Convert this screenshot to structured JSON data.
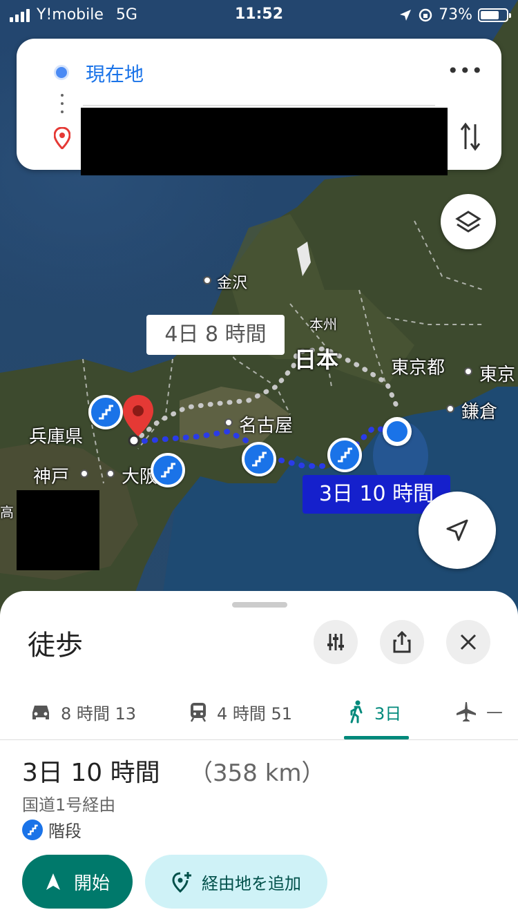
{
  "status_bar": {
    "carrier": "Y!mobile",
    "network": "5G",
    "time": "11:52",
    "battery": "73%"
  },
  "search": {
    "origin": "現在地",
    "destination": ""
  },
  "map": {
    "labels": {
      "kanazawa": "金沢",
      "honshu": "本州",
      "nihon": "日本",
      "tokyo_to": "東京都",
      "tokyo": "東京",
      "kamakura": "鎌倉",
      "nagoya": "名古屋",
      "hyogo": "兵庫県",
      "kobe": "神戸",
      "osaka": "大阪",
      "edge": "高"
    },
    "route_alt_time": "4日 8 時間",
    "route_main_time": "3日 10 時間"
  },
  "sheet": {
    "mode_title": "徒歩",
    "tabs": [
      {
        "icon": "car-icon",
        "label": "8 時間 13"
      },
      {
        "icon": "train-icon",
        "label": "4 時間 51"
      },
      {
        "icon": "walk-icon",
        "label": "3日"
      },
      {
        "icon": "plane-icon",
        "label": "—"
      }
    ],
    "summary": {
      "duration": "3日 10 時間",
      "distance": "（358 km）",
      "via": "国道1号経由",
      "warning": "階段"
    },
    "start_label": "開始",
    "add_waypoint_label": "経由地を追加"
  },
  "colors": {
    "accent_teal": "#00796b",
    "route_blue": "#1520cc",
    "origin_blue": "#1a73e8",
    "pin_red": "#e53935"
  }
}
